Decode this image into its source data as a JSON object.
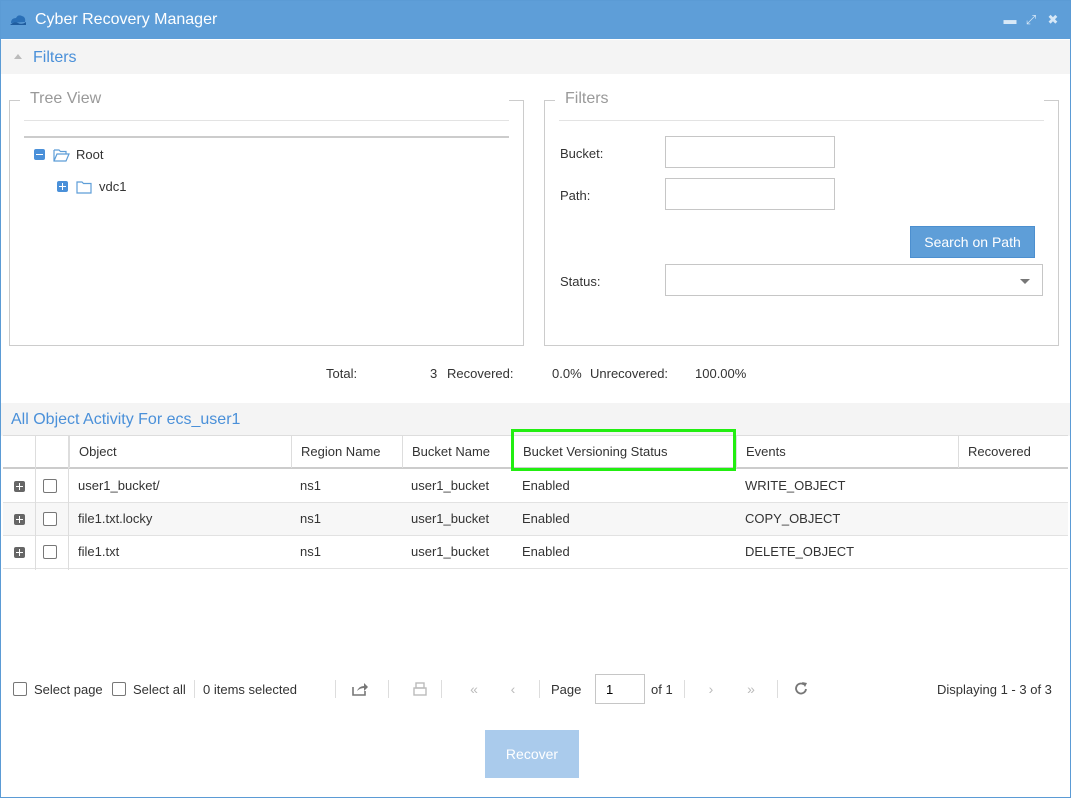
{
  "window": {
    "title": "Cyber Recovery Manager"
  },
  "filters_panel": {
    "label": "Filters"
  },
  "tree_view": {
    "legend": "Tree View",
    "root": {
      "label": "Root",
      "children": [
        {
          "label": "vdc1"
        }
      ]
    }
  },
  "filters_box": {
    "legend": "Filters",
    "bucket_label": "Bucket:",
    "bucket_value": "",
    "path_label": "Path:",
    "path_value": "",
    "search_button": "Search on Path",
    "status_label": "Status:",
    "status_value": ""
  },
  "summary": {
    "total_label": "Total:",
    "total_value": "3",
    "recovered_label": "Recovered:",
    "recovered_value": "0.0%",
    "unrecovered_label": "Unrecovered:",
    "unrecovered_value": "100.00%"
  },
  "grid": {
    "title": "All Object Activity For ecs_user1",
    "columns": [
      "Object",
      "Region Name",
      "Bucket Name",
      "Bucket Versioning Status",
      "Events",
      "Recovered"
    ],
    "rows": [
      {
        "object": "user1_bucket/",
        "region": "ns1",
        "bucket": "user1_bucket",
        "versioning": "Enabled",
        "event": "WRITE_OBJECT",
        "recovered": ""
      },
      {
        "object": "file1.txt.locky",
        "region": "ns1",
        "bucket": "user1_bucket",
        "versioning": "Enabled",
        "event": "COPY_OBJECT",
        "recovered": ""
      },
      {
        "object": "file1.txt",
        "region": "ns1",
        "bucket": "user1_bucket",
        "versioning": "Enabled",
        "event": "DELETE_OBJECT",
        "recovered": ""
      }
    ],
    "highlight_color": "#22ee11"
  },
  "pager": {
    "select_page": "Select page",
    "select_all": "Select all",
    "items_selected": "0 items selected",
    "page_label": "Page",
    "page_value": "1",
    "of_label": "of 1",
    "displaying": "Displaying 1 - 3 of 3"
  },
  "recover_button": "Recover",
  "colors": {
    "accent": "#5e9ed8",
    "link": "#4a90d9",
    "disabled_button": "#aacbec"
  }
}
